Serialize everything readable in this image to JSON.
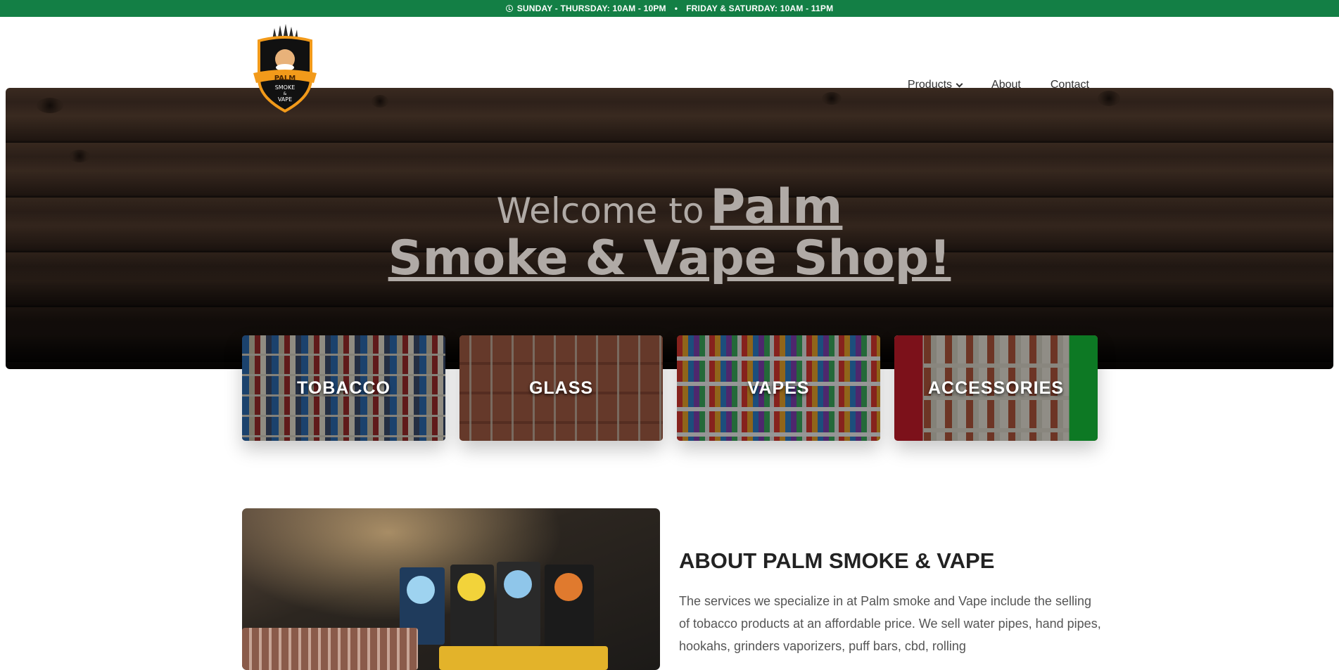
{
  "topbar": {
    "hours_weekday": "SUNDAY - THURSDAY: 10AM - 10PM",
    "separator": "•",
    "hours_weekend": "FRIDAY & SATURDAY: 10AM - 11PM"
  },
  "logo": {
    "top_text": "PALM",
    "line1": "SMOKE",
    "line2": "&",
    "line3": "VAPE"
  },
  "nav": {
    "items": [
      {
        "label": "Products",
        "has_dropdown": true
      },
      {
        "label": "About"
      },
      {
        "label": "Contact"
      }
    ]
  },
  "hero": {
    "welcome": "Welcome to",
    "palm": "Palm",
    "line2": "Smoke & Vape Shop!"
  },
  "categories": [
    {
      "label": "TOBACCO"
    },
    {
      "label": "GLASS"
    },
    {
      "label": "VAPES"
    },
    {
      "label": "ACCESSORIES"
    }
  ],
  "about": {
    "title_bold": "ABOUT",
    "title_rest": " PALM SMOKE & VAPE",
    "text": "The services we specialize in at Palm smoke and Vape include the selling of tobacco products at an affordable price. We sell water pipes, hand pipes, hookahs, grinders vaporizers, puff bars, cbd, rolling"
  },
  "colors": {
    "topbar_bg": "#137f45",
    "logo_orange": "#f29a1a"
  }
}
